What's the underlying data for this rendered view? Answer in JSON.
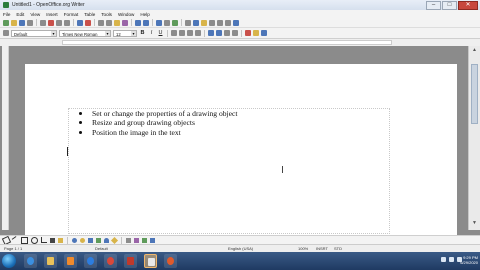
{
  "window": {
    "title": "Untitled1 - OpenOffice.org Writer",
    "controls": {
      "minimize": "–",
      "maximize": "□",
      "close": "✕"
    }
  },
  "menu": [
    "File",
    "Edit",
    "View",
    "Insert",
    "Format",
    "Table",
    "Tools",
    "Window",
    "Help"
  ],
  "format_toolbar": {
    "style": "Default",
    "font": "Times New Roman",
    "size": "12",
    "bold": "B",
    "italic": "I",
    "underline": "U"
  },
  "document": {
    "bullets": [
      "Set or change the properties of a drawing object",
      "Resize and group drawing objects",
      "Position the image in the text"
    ]
  },
  "statusbar": {
    "page": "Page 1 / 1",
    "style": "Default",
    "language": "English (USA)",
    "zoom": "100%",
    "mode": "INSRT",
    "selection": "STD"
  },
  "taskbar": {
    "time": "9:29 PM",
    "date": "6/29/2020"
  },
  "colors": {
    "desktop_bg": "#8b8b8b",
    "taskbar": "#1f3a62",
    "close_button": "#c8473d"
  }
}
